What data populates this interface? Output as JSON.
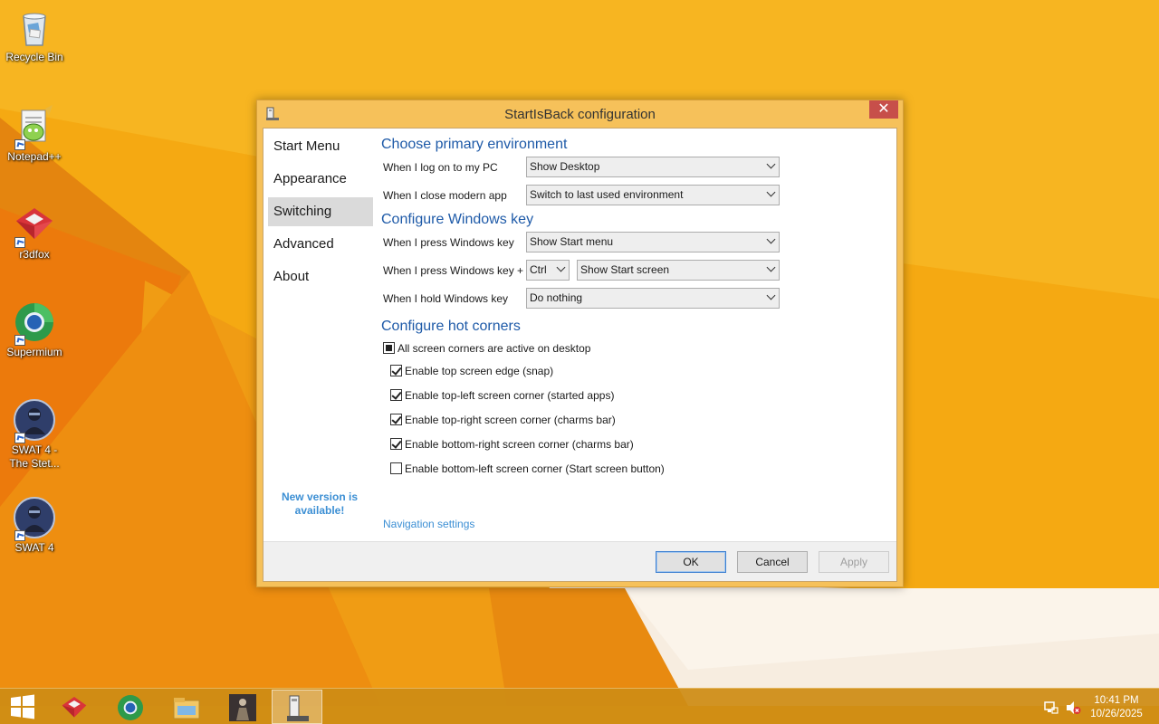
{
  "desktop": {
    "icons": [
      {
        "label": "Recycle Bin",
        "icon": "recycle-bin-icon"
      },
      {
        "label": "Notepad++",
        "icon": "notepadpp-icon"
      },
      {
        "label": "r3dfox",
        "icon": "r3dfox-icon"
      },
      {
        "label": "Supermium",
        "icon": "supermium-icon"
      },
      {
        "label": "SWAT 4 - The Stet...",
        "icon": "swat4-stetchkov-icon"
      },
      {
        "label": "SWAT 4",
        "icon": "swat4-icon"
      }
    ]
  },
  "dialog": {
    "title": "StartIsBack configuration",
    "close_glyph": "✕",
    "nav": {
      "items": [
        "Start Menu",
        "Appearance",
        "Switching",
        "Advanced",
        "About"
      ],
      "selected": "Switching",
      "update_note": "New version is available!"
    },
    "primary_env": {
      "heading": "Choose primary environment",
      "logon_label": "When I log on to my PC",
      "logon_value": "Show Desktop",
      "close_modern_label": "When I close modern app",
      "close_modern_value": "Switch to last used environment"
    },
    "windows_key": {
      "heading": "Configure Windows key",
      "press_label": "When I press Windows key",
      "press_value": "Show Start menu",
      "press_combo_label": "When I press Windows key +",
      "modifier_value": "Ctrl",
      "combo_value": "Show Start screen",
      "hold_label": "When I hold Windows key",
      "hold_value": "Do nothing"
    },
    "hot_corners": {
      "heading": "Configure hot corners",
      "all_corners": {
        "label": "All screen corners are active on desktop",
        "state": "indeterminate"
      },
      "options": [
        {
          "label": "Enable top screen edge (snap)",
          "checked": true
        },
        {
          "label": "Enable top-left screen corner (started apps)",
          "checked": true
        },
        {
          "label": "Enable top-right screen corner (charms bar)",
          "checked": true
        },
        {
          "label": "Enable bottom-right screen corner (charms bar)",
          "checked": true
        },
        {
          "label": "Enable bottom-left screen corner (Start screen button)",
          "checked": false
        }
      ]
    },
    "navigation_link": "Navigation settings",
    "buttons": {
      "ok": "OK",
      "cancel": "Cancel",
      "apply": "Apply",
      "apply_enabled": false
    }
  },
  "taskbar": {
    "pinned": [
      "start-icon",
      "r3dfox-icon",
      "supermium-icon",
      "file-explorer-icon",
      "swat4-icon",
      "startisback-icon"
    ],
    "active": "startisback-icon",
    "tray": [
      "network-icon",
      "volume-muted-icon"
    ],
    "clock": {
      "time": "10:41 PM",
      "date": "10/26/2025"
    }
  },
  "colors": {
    "wallpaper": "#f4a410",
    "accent_heading": "#1e5aa8",
    "link": "#3c8fd4",
    "close_button": "#c74f4a",
    "dialog_frame": "#f6c15a"
  }
}
